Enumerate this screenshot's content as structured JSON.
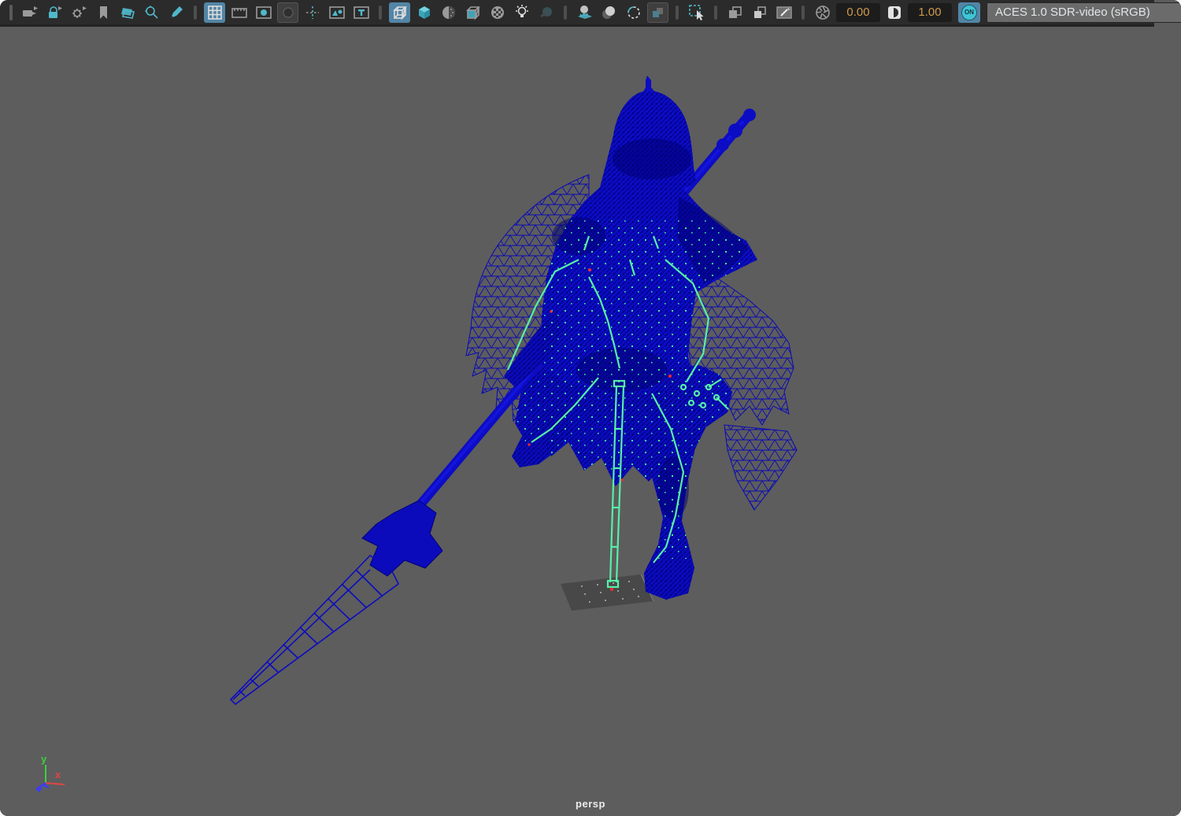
{
  "colors": {
    "viewport_bg": "#5d5d5d",
    "toolbar_bg": "#2b2b2b",
    "accent_teal": "#4fb8c9",
    "active_highlight_blue": "#5285a6",
    "selection_wireframe_blue": "#0d0dc8",
    "wireframe_dark_blue": "#000078",
    "skeleton_green": "#57efa7",
    "joint_pivot_red": "#ff2a2a",
    "field_text_orange": "#cf9a4d",
    "axis_x_red": "#e04545",
    "axis_y_green": "#3bd23b",
    "axis_z_blue": "#3b3bff"
  },
  "toolbar": {
    "icons": [
      {
        "name": "select-camera",
        "state": "normal"
      },
      {
        "name": "lock-camera",
        "state": "normal"
      },
      {
        "name": "camera-attributes",
        "state": "normal"
      },
      {
        "name": "bookmark",
        "state": "normal"
      },
      {
        "name": "image-plane",
        "state": "normal"
      },
      {
        "name": "2d-pan-zoom",
        "state": "normal"
      },
      {
        "name": "grease-pencil",
        "state": "normal"
      },
      {
        "name": "grid",
        "state": "active"
      },
      {
        "name": "film-gate",
        "state": "normal"
      },
      {
        "name": "resolution-gate",
        "state": "normal"
      },
      {
        "name": "gate-mask",
        "state": "pressed"
      },
      {
        "name": "field-chart",
        "state": "normal"
      },
      {
        "name": "safe-action",
        "state": "normal"
      },
      {
        "name": "safe-title",
        "state": "normal"
      },
      {
        "name": "wireframe-display",
        "state": "active"
      },
      {
        "name": "smooth-shade-all",
        "state": "normal"
      },
      {
        "name": "textured",
        "state": "normal"
      },
      {
        "name": "wireframe-on-shaded",
        "state": "normal"
      },
      {
        "name": "use-default-material",
        "state": "normal"
      },
      {
        "name": "all-lights",
        "state": "normal"
      },
      {
        "name": "shadows",
        "state": "disabled"
      },
      {
        "name": "ambient-occlusion",
        "state": "normal"
      },
      {
        "name": "motion-blur",
        "state": "normal"
      },
      {
        "name": "anti-aliasing",
        "state": "normal"
      },
      {
        "name": "depth-of-field",
        "state": "pressed"
      },
      {
        "name": "isolate-select",
        "state": "normal"
      },
      {
        "name": "xray",
        "state": "normal"
      },
      {
        "name": "xray-joints",
        "state": "normal"
      },
      {
        "name": "snapshot-pen",
        "state": "normal"
      },
      {
        "name": "exposure",
        "state": "normal"
      },
      {
        "name": "gamma",
        "state": "normal"
      }
    ],
    "exposure_value": "0.00",
    "gamma_value": "1.00",
    "color_management_toggle": "ON",
    "view_transform": "ACES 1.0 SDR-video (sRGB)"
  },
  "viewport": {
    "camera_label": "persp",
    "axis_gizmo": {
      "x_label": "x",
      "y_label": "y"
    },
    "scene": {
      "description": "selected knight character mesh in wireframe with spear, visible joint skeleton and ground plane",
      "selection_color": "#0d0dc8",
      "skeleton_color": "#57efa7"
    }
  }
}
